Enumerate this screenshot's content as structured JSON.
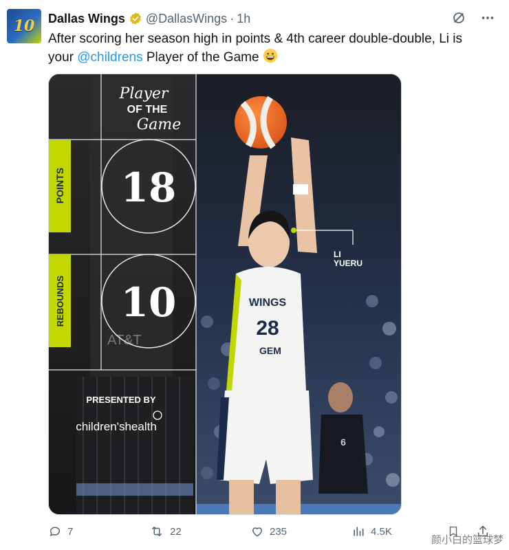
{
  "tweet": {
    "author_name": "Dallas Wings",
    "author_handle": "@DallasWings",
    "separator": "·",
    "timestamp": "1h",
    "text_before": "After scoring her season high in points & 4th career double-double, Li is your ",
    "mention": "@childrens",
    "text_after": " Player of the Game ",
    "emoji": "grinning-face",
    "avatar_text": "10"
  },
  "graphic": {
    "title_line1": "Player",
    "title_line2": "OF THE",
    "title_line3": "Game",
    "stat1_label": "POINTS",
    "stat1_value": "18",
    "stat2_label": "REBOUNDS",
    "stat2_value": "10",
    "player_first": "LI",
    "player_last": "YUERU",
    "presented_by": "PRESENTED BY",
    "sponsor": "children'shealth",
    "jersey_team": "WINGS",
    "jersey_number": "28",
    "jersey_sponsor": "GEM",
    "court_sign": "AT&T",
    "accent_color": "#c4d600"
  },
  "actions": {
    "replies": "7",
    "retweets": "22",
    "likes": "235",
    "views": "4.5K"
  },
  "watermark": "颜小白的篮球梦",
  "icons": [
    "verified-badge-icon",
    "grok-icon",
    "more-icon",
    "reply-icon",
    "retweet-icon",
    "like-icon",
    "views-icon",
    "bookmark-icon",
    "share-icon"
  ]
}
